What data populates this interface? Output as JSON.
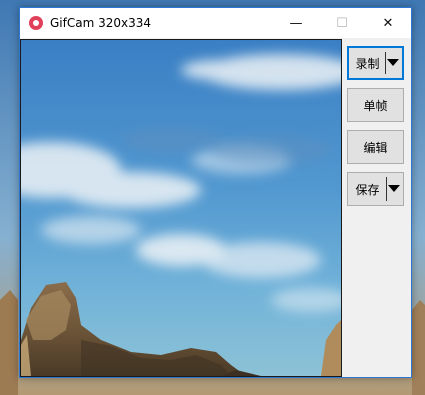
{
  "window": {
    "title": "GifCam 320x334",
    "controls": {
      "minimize": "—",
      "maximize": "☐",
      "close": "✕"
    }
  },
  "panel": {
    "record_label": "录制",
    "frame_label": "单帧",
    "edit_label": "编辑",
    "save_label": "保存"
  },
  "icons": {
    "app": "gifcam-icon",
    "dropdown": "triangle-down"
  },
  "colors": {
    "accent_border": "#0078d7",
    "app_icon": "#e0405a"
  }
}
